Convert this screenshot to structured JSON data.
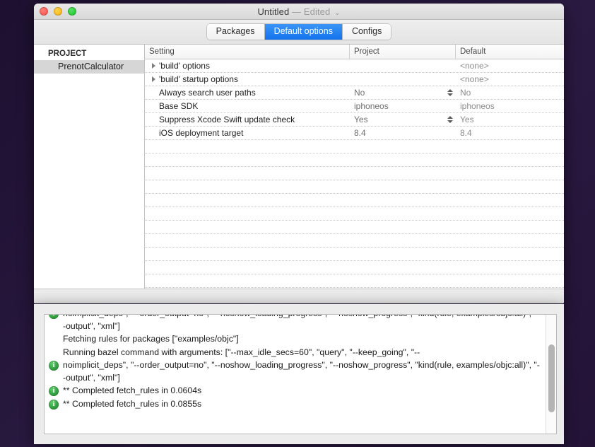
{
  "window": {
    "title_main": "Untitled",
    "title_sep": "—",
    "title_state": "Edited",
    "title_chevron": "⌄",
    "traffic": {
      "close_label": "close-window",
      "minimize_label": "minimize-window",
      "zoom_label": "zoom-window"
    }
  },
  "toolbar": {
    "tabs": [
      {
        "label": "Packages",
        "active": false
      },
      {
        "label": "Default options",
        "active": true
      },
      {
        "label": "Configs",
        "active": false
      }
    ]
  },
  "sidebar": {
    "header": "PROJECT",
    "items": [
      {
        "label": "PrenotCalculator",
        "selected": true
      }
    ]
  },
  "table": {
    "columns": [
      "Setting",
      "Project",
      "Default"
    ],
    "rows": [
      {
        "setting": "'build' options",
        "disclosure": true,
        "project": "",
        "default": "<none>",
        "stepper": false
      },
      {
        "setting": "'build' startup options",
        "disclosure": true,
        "project": "",
        "default": "<none>",
        "stepper": false
      },
      {
        "setting": "Always search user paths",
        "disclosure": false,
        "project": "No",
        "default": "No",
        "stepper": true
      },
      {
        "setting": "Base SDK",
        "disclosure": false,
        "project": "iphoneos",
        "default": "iphoneos",
        "stepper": false
      },
      {
        "setting": "Suppress Xcode Swift update check",
        "disclosure": false,
        "project": "Yes",
        "default": "Yes",
        "stepper": true
      },
      {
        "setting": "iOS deployment target",
        "disclosure": false,
        "project": "8.4",
        "default": "8.4",
        "stepper": false
      }
    ],
    "empty_row_count": 17
  },
  "console": {
    "lines": [
      {
        "icon": "info-icon",
        "text": "noimplicit_deps\", \"--order_output=no\", \"--noshow_loading_progress\", \"--noshow_progress\", \"kind(rule, examples/objc:all)\", \"--output\", \"xml\"]"
      },
      {
        "icon": "none",
        "text": "Fetching rules for packages [\"examples/objc\"]"
      },
      {
        "icon": "none",
        "text": "Running bazel command with arguments: [\"--max_idle_secs=60\", \"query\", \"--keep_going\", \"--"
      },
      {
        "icon": "info-icon",
        "text": "noimplicit_deps\", \"--order_output=no\", \"--noshow_loading_progress\", \"--noshow_progress\", \"kind(rule, examples/objc:all)\", \"--output\", \"xml\"]"
      },
      {
        "icon": "info-icon",
        "text": "** Completed fetch_rules in 0.0604s"
      },
      {
        "icon": "info-icon",
        "text": "** Completed fetch_rules in 0.0855s"
      }
    ]
  },
  "colors": {
    "accent": "#1272ec",
    "desktop": "#241337",
    "info_green": "#2e9b3c",
    "selection_gray": "#d6d6d6"
  }
}
